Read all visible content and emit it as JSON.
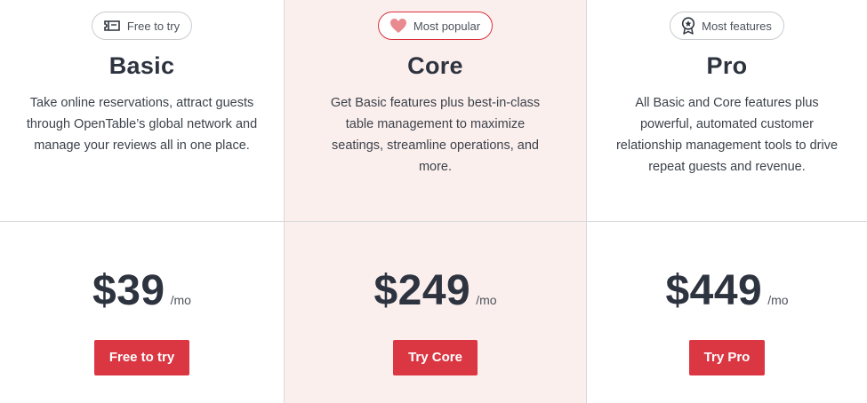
{
  "accent_color": "#da3743",
  "plans": [
    {
      "badge_icon": "ticket-icon",
      "badge_label": "Free to try",
      "title": "Basic",
      "description": "Take online reservations, attract guests through OpenTable’s global network and manage your reviews all in one place.",
      "price": "$39",
      "period": "/mo",
      "cta_label": "Free to try"
    },
    {
      "badge_icon": "heart-icon",
      "badge_label": "Most popular",
      "title": "Core",
      "description": "Get Basic features plus best-in-class table management to maximize seatings, streamline operations, and more.",
      "price": "$249",
      "period": "/mo",
      "cta_label": "Try Core"
    },
    {
      "badge_icon": "award-ribbon-icon",
      "badge_label": "Most features",
      "title": "Pro",
      "description": "All Basic and Core features plus powerful, automated customer relationship management tools to drive repeat guests and revenue.",
      "price": "$449",
      "period": "/mo",
      "cta_label": "Try Pro"
    }
  ]
}
